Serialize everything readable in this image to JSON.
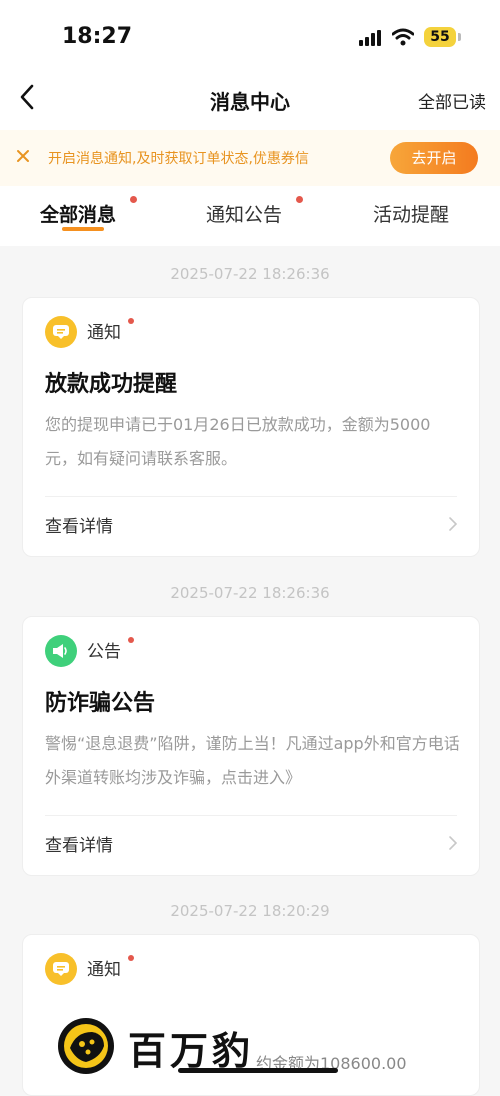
{
  "status_bar": {
    "time": "18:27",
    "battery": "55"
  },
  "nav": {
    "title": "消息中心",
    "mark_all_read": "全部已读"
  },
  "notice": {
    "text": "开启消息通知,及时获取订单状态,优惠券信",
    "button": "去开启"
  },
  "tabs": [
    {
      "label": "全部消息",
      "active": true,
      "has_dot": true
    },
    {
      "label": "通知公告",
      "active": false,
      "has_dot": true
    },
    {
      "label": "活动提醒",
      "active": false,
      "has_dot": false
    }
  ],
  "messages": [
    {
      "timestamp": "2025-07-22  18:26:36",
      "type": "通知",
      "icon": "notice-icon",
      "icon_color": "#f8c02a",
      "title": "放款成功提醒",
      "body": "您的提现申请已于01月26日已放款成功，金额为5000元，如有疑问请联系客服。",
      "action": "查看详情"
    },
    {
      "timestamp": "2025-07-22  18:26:36",
      "type": "公告",
      "icon": "megaphone-icon",
      "icon_color": "#3fd07b",
      "title": "防诈骗公告",
      "body": "警惕“退息退费”陷阱，谨防上当！凡通过app外和官方电话外渠道转账均涉及诈骗，点击进入》",
      "action": "查看详情"
    },
    {
      "timestamp": "2025-07-22  18:20:29",
      "type": "通知",
      "icon": "notice-icon",
      "icon_color": "#f8c02a"
    }
  ],
  "watermark": {
    "brand": "百万豹",
    "bottom_text": "约金额为108600.00"
  },
  "colors": {
    "accent": "#f5901f",
    "notice_text": "#e89421",
    "badge_dot": "#e4584c"
  }
}
